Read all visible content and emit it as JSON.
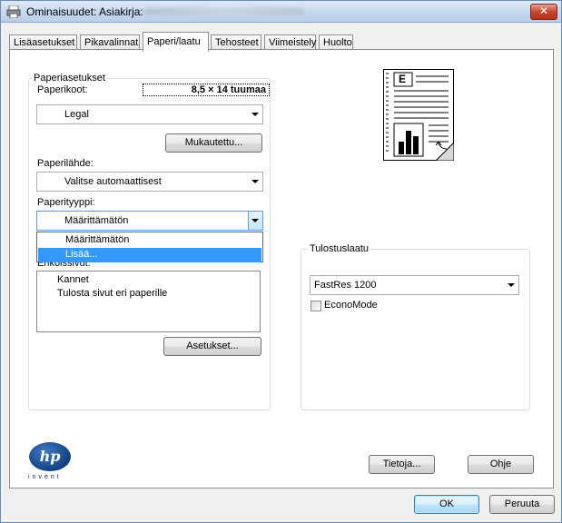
{
  "window": {
    "title": "Ominaisuudet: Asiakirja:",
    "close_label": "✕"
  },
  "tabs": [
    {
      "label": "Lisäasetukset"
    },
    {
      "label": "Pikavalinnat"
    },
    {
      "label": "Paperi/laatu",
      "active": true
    },
    {
      "label": "Tehosteet"
    },
    {
      "label": "Viimeistely"
    },
    {
      "label": "Huolto"
    }
  ],
  "paper_options": {
    "group_label": "Paperiasetukset",
    "size_label": "Paperikoot:",
    "size_value": "8,5 × 14 tuumaa",
    "size_combo_value": "Legal",
    "custom_button": "Mukautettu...",
    "source_label": "Paperilähde:",
    "source_value": "Valitse automaattisest",
    "type_label": "Paperityyppi:",
    "type_value": "Määrittämätön",
    "type_dropdown_options": [
      "Määrittämätön",
      "Lisää..."
    ],
    "type_dropdown_selected": "Lisää...",
    "special_pages_label": "Erikoissivut:",
    "special_pages_items": [
      "Kannet",
      "Tulosta sivut eri paperille"
    ],
    "settings_button": "Asetukset..."
  },
  "print_quality": {
    "group_label": "Tulostuslaatu",
    "value": "FastRes 1200",
    "econo_label": "EconoMode",
    "econo_checked": false
  },
  "preview": {
    "letter": "E"
  },
  "brand": {
    "logo_text": "hp",
    "tagline": "invent"
  },
  "buttons": {
    "about": "Tietoja...",
    "help": "Ohje",
    "ok": "OK",
    "cancel": "Peruuta"
  },
  "colors": {
    "selection": "#3399ff",
    "hp_blue": "#14417f",
    "focus_border": "#569de5"
  }
}
